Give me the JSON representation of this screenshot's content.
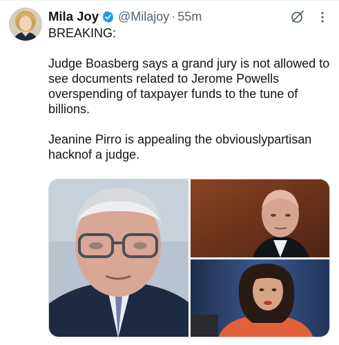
{
  "tweet": {
    "author_name": "Mila Joy",
    "handle": "@Milajoy",
    "separator": "·",
    "time": "55m",
    "paragraphs": [
      "BREAKING:",
      "Judge Boasberg says a grand jury is not allowed to see documents related to Jerome Powells overspending of taxpayer funds to the tune of billions.",
      "Jeanine Pirro is appealing the obviouslypartisan hacknof a judge."
    ]
  },
  "icons": {
    "verified": "verified-badge-icon",
    "grok": "grok-icon",
    "more": "more-options-icon"
  },
  "colors": {
    "verified_blue": "#1d9bf0",
    "secondary_text": "#536471",
    "primary_text": "#0f1419"
  }
}
